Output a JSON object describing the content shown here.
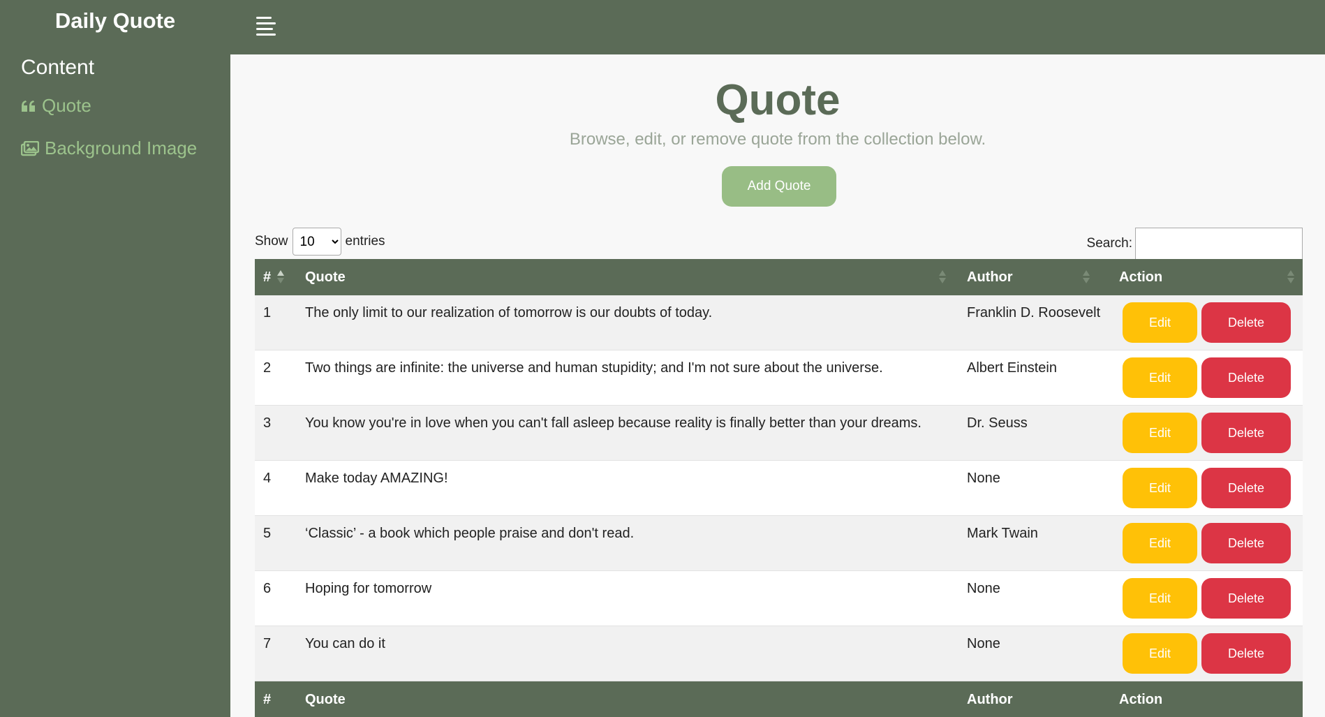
{
  "app": {
    "brand": "Daily Quote"
  },
  "sidebar": {
    "section_title": "Content",
    "items": [
      {
        "label": "Quote",
        "icon": "quote-left-icon"
      },
      {
        "label": "Background Image",
        "icon": "images-icon"
      }
    ]
  },
  "main": {
    "title": "Quote",
    "subtitle": "Browse, edit, or remove quote from the collection below.",
    "add_button": "Add Quote"
  },
  "table_controls": {
    "show_label": "Show",
    "entries_label": "entries",
    "page_length": "10",
    "page_length_options": [
      "10"
    ],
    "search_label": "Search:",
    "search_value": ""
  },
  "table": {
    "columns": [
      "#",
      "Quote",
      "Author",
      "Action"
    ],
    "rows": [
      {
        "num": "1",
        "quote": "The only limit to our realization of tomorrow is our doubts of today.",
        "author": "Franklin D. Roosevelt"
      },
      {
        "num": "2",
        "quote": "Two things are infinite: the universe and human stupidity; and I'm not sure about the universe.",
        "author": "Albert Einstein"
      },
      {
        "num": "3",
        "quote": "You know you're in love when you can't fall asleep because reality is finally better than your dreams.",
        "author": "Dr. Seuss"
      },
      {
        "num": "4",
        "quote": "Make today AMAZING!",
        "author": "None"
      },
      {
        "num": "5",
        "quote": "‘Classic’ - a book which people praise and don't read.",
        "author": "Mark Twain"
      },
      {
        "num": "6",
        "quote": "Hoping for tomorrow",
        "author": "None"
      },
      {
        "num": "7",
        "quote": "You can do it",
        "author": "None"
      }
    ],
    "edit_label": "Edit",
    "delete_label": "Delete"
  },
  "colors": {
    "sidebar_bg": "#5b6b57",
    "accent_green": "#98bd85",
    "nav_link": "#9cc38c",
    "edit": "#ffc107",
    "delete": "#dc3545"
  }
}
